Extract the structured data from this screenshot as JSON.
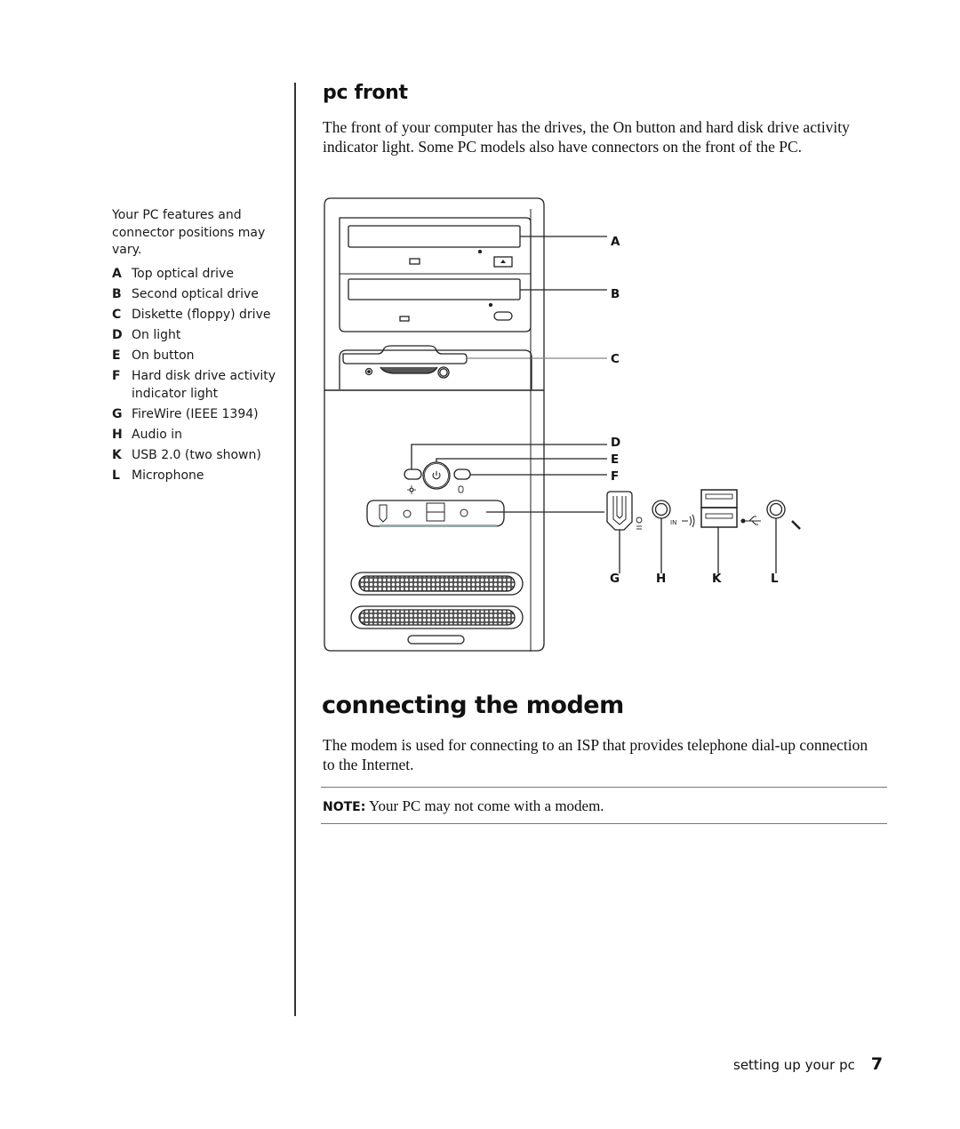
{
  "sidebar": {
    "note": "Your PC features and connector positions may vary.",
    "legend": [
      {
        "key": "A",
        "text": "Top optical drive"
      },
      {
        "key": "B",
        "text": "Second optical drive"
      },
      {
        "key": "C",
        "text": "Diskette (floppy) drive"
      },
      {
        "key": "D",
        "text": "On light"
      },
      {
        "key": "E",
        "text": "On button"
      },
      {
        "key": "F",
        "text": "Hard disk drive activity indicator light"
      },
      {
        "key": "G",
        "text": "FireWire (IEEE 1394)"
      },
      {
        "key": "H",
        "text": "Audio in"
      },
      {
        "key": "K",
        "text": "USB 2.0 (two shown)"
      },
      {
        "key": "L",
        "text": "Microphone"
      }
    ]
  },
  "pc_front": {
    "heading": "pc front",
    "body": "The front of your computer has the drives, the On button and hard disk drive activity indicator light. Some PC models also have connectors on the front of the PC."
  },
  "diagram": {
    "callouts": {
      "A": "A",
      "B": "B",
      "C": "C",
      "D": "D",
      "E": "E",
      "F": "F",
      "G": "G",
      "H": "H",
      "K": "K",
      "L": "L"
    },
    "audio_in_marker": "IN"
  },
  "modem": {
    "heading": "connecting the modem",
    "body": "The modem is used for connecting to an ISP that provides telephone dial-up connection to the Internet.",
    "note_label": "NOTE:",
    "note_text": " Your PC may not come with a modem."
  },
  "footer": {
    "section": "setting up your pc",
    "page_number": "7"
  }
}
